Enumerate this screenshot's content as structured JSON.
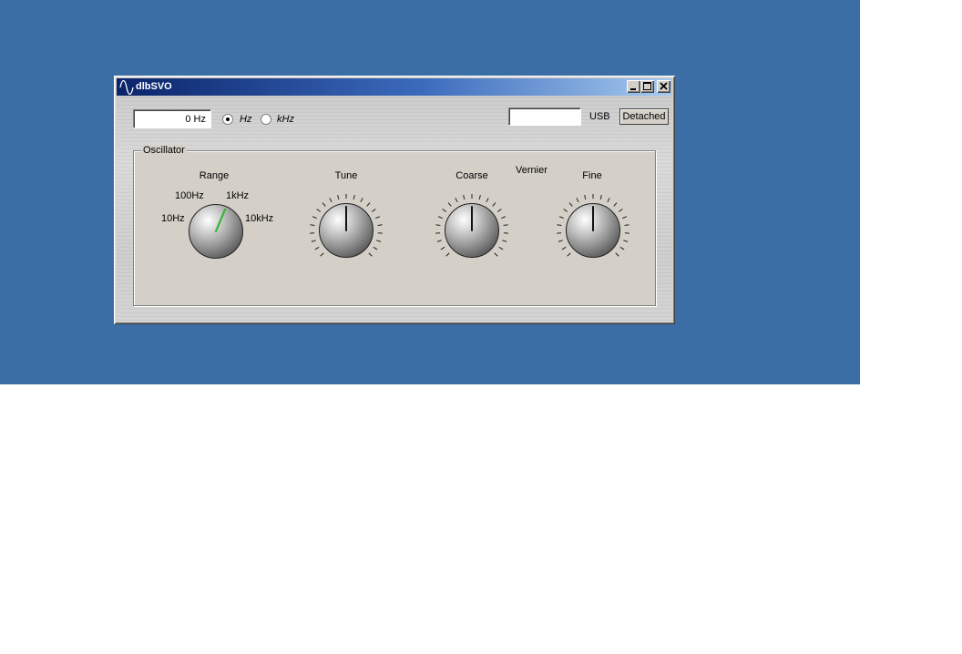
{
  "window": {
    "title": "dlbSVO"
  },
  "frequency": {
    "value": "0 Hz"
  },
  "units": {
    "hz_label": "Hz",
    "khz_label": "kHz",
    "selected": "Hz"
  },
  "usb": {
    "value": "",
    "label": "USB",
    "status": "Detached"
  },
  "oscillator": {
    "title": "Oscillator",
    "range": {
      "label": "Range",
      "positions": [
        "10Hz",
        "100Hz",
        "1kHz",
        "10kHz"
      ],
      "selected": "1kHz",
      "indicator_color": "#33b533"
    },
    "tune": {
      "label": "Tune"
    },
    "vernier": {
      "label": "Vernier"
    },
    "coarse": {
      "label": "Coarse"
    },
    "fine": {
      "label": "Fine"
    }
  }
}
